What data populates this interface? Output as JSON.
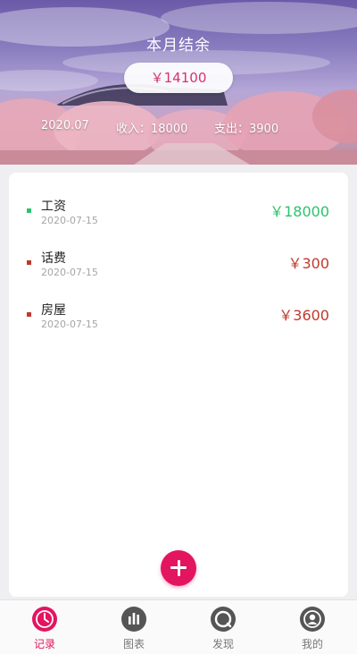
{
  "header": {
    "title": "本月结余",
    "balance": "￥14100",
    "month": "2020.07",
    "income": "收入：18000",
    "expense": "支出：3900"
  },
  "records": [
    {
      "name": "工资",
      "date": "2020-07-15",
      "amount": "￥18000",
      "type": "income",
      "color": "#2bc46c"
    },
    {
      "name": "话费",
      "date": "2020-07-15",
      "amount": "￥300",
      "type": "expense",
      "color": "#c0392b"
    },
    {
      "name": "房屋",
      "date": "2020-07-15",
      "amount": "￥3600",
      "type": "expense",
      "color": "#c0392b"
    }
  ],
  "nav": [
    {
      "label": "记录",
      "icon": "clock-icon",
      "active": true
    },
    {
      "label": "图表",
      "icon": "bar-chart-icon",
      "active": false
    },
    {
      "label": "发现",
      "icon": "discover-icon",
      "active": false
    },
    {
      "label": "我的",
      "icon": "user-icon",
      "active": false
    }
  ],
  "colors": {
    "accent": "#e3155e",
    "income": "#2bc46c",
    "expense": "#c0392b",
    "nav_inactive": "#555555"
  }
}
